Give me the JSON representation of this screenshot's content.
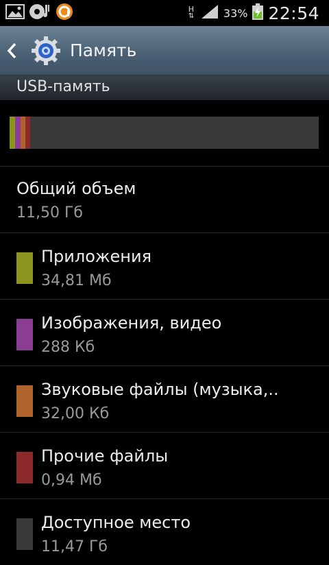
{
  "status_bar": {
    "network_type": "H",
    "battery_percent": "33%",
    "time": "22:54",
    "icons": [
      "gallery-icon",
      "music-notification-icon",
      "app-notification-icon",
      "data-transfer-icon",
      "signal-icon",
      "battery-charging-icon"
    ]
  },
  "action_bar": {
    "title": "Память",
    "icon": "settings-gear-icon"
  },
  "section": {
    "title": "USB-память"
  },
  "usage_bar": {
    "segments": [
      {
        "name": "apps",
        "color": "#8c9420",
        "fraction": 0.018
      },
      {
        "name": "images",
        "color": "#8b3d94",
        "fraction": 0.017
      },
      {
        "name": "audio",
        "color": "#b0622b",
        "fraction": 0.016
      },
      {
        "name": "other",
        "color": "#8c2a2c",
        "fraction": 0.016
      }
    ],
    "free_color": "#3a3a3a"
  },
  "total": {
    "label": "Общий объем",
    "value": "11,50 Гб"
  },
  "items": [
    {
      "name": "Приложения",
      "value": "34,81 Мб",
      "color": "#8c9420"
    },
    {
      "name": "Изображения, видео",
      "value": "288 Кб",
      "color": "#8b3d94"
    },
    {
      "name": "Звуковые файлы (музыка,..",
      "value": "32,00 Кб",
      "color": "#b0622b"
    },
    {
      "name": "Прочие файлы",
      "value": "0,94 Мб",
      "color": "#8c2a2c"
    },
    {
      "name": "Доступное место",
      "value": "11,47 Гб",
      "color": "#3a3a3a"
    }
  ]
}
